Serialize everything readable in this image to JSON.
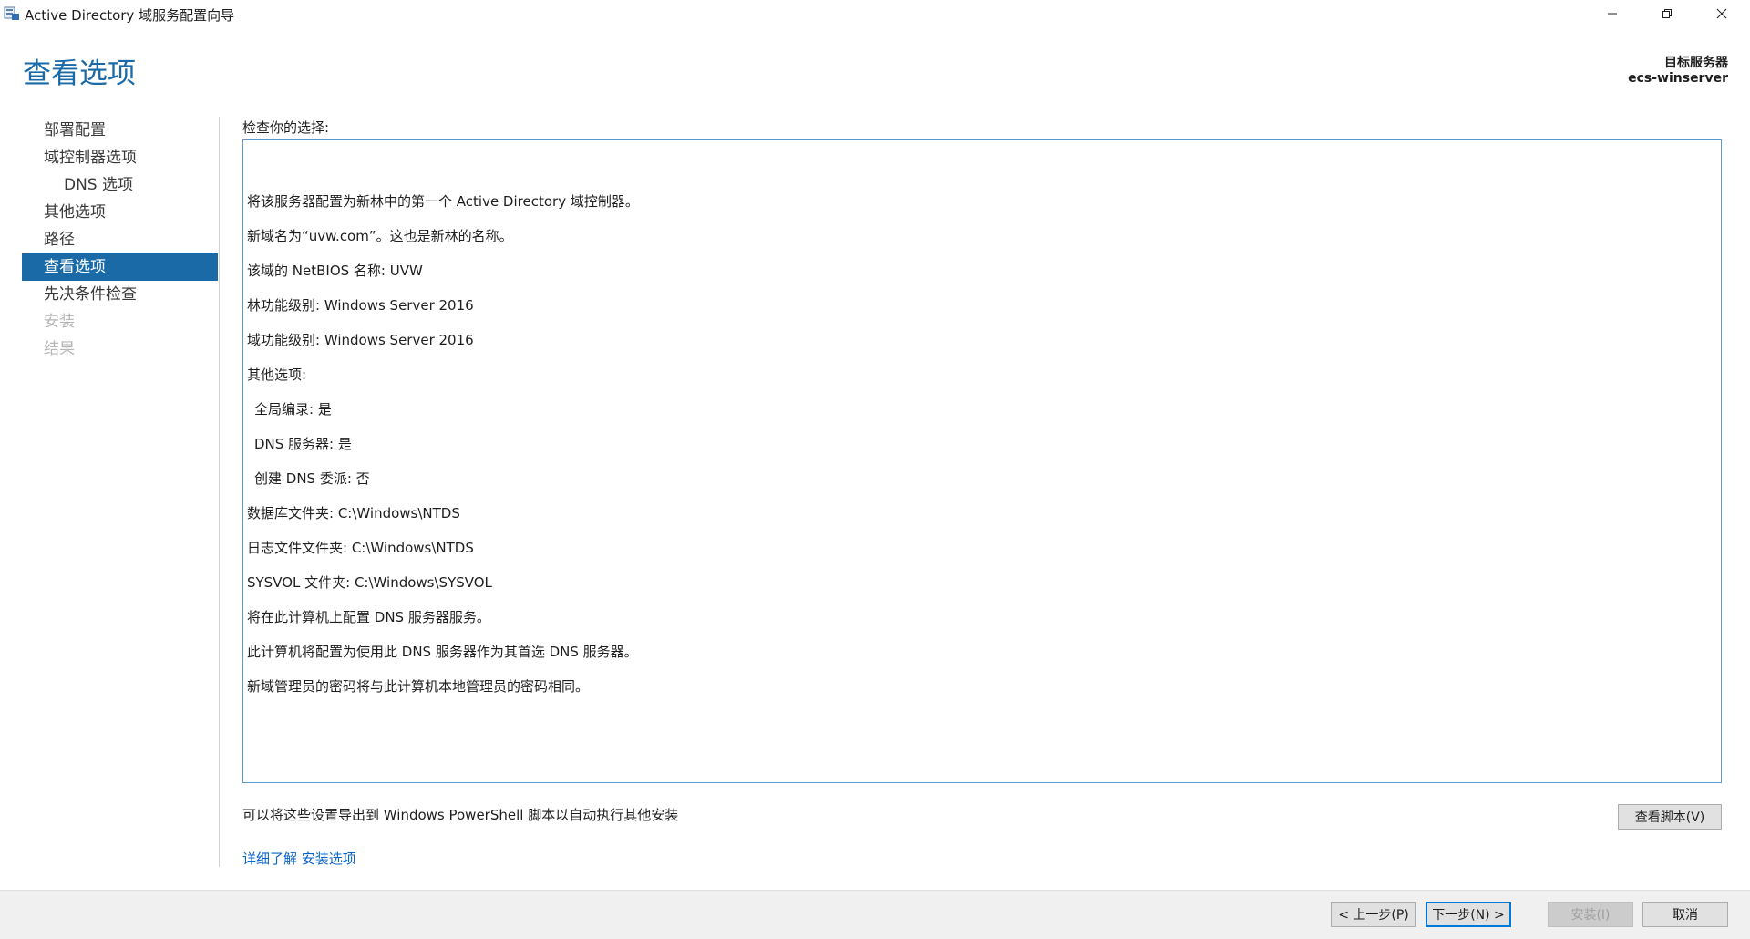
{
  "window": {
    "title": "Active Directory 域服务配置向导",
    "icon": "server-icon"
  },
  "header": {
    "page_title": "查看选项",
    "target_server_label": "目标服务器",
    "target_server_name": "ecs-winserver"
  },
  "nav": {
    "items": [
      {
        "label": "部署配置",
        "state": "normal"
      },
      {
        "label": "域控制器选项",
        "state": "normal"
      },
      {
        "label": "DNS 选项",
        "state": "sub"
      },
      {
        "label": "其他选项",
        "state": "normal"
      },
      {
        "label": "路径",
        "state": "normal"
      },
      {
        "label": "查看选项",
        "state": "active"
      },
      {
        "label": "先决条件检查",
        "state": "normal"
      },
      {
        "label": "安装",
        "state": "disabled"
      },
      {
        "label": "结果",
        "state": "disabled"
      }
    ]
  },
  "review": {
    "label": "检查你的选择:",
    "lines": [
      "将该服务器配置为新林中的第一个 Active Directory 域控制器。",
      "新域名为“uvw.com”。这也是新林的名称。",
      "该域的 NetBIOS 名称: UVW",
      "林功能级别: Windows Server 2016",
      "域功能级别: Windows Server 2016",
      "其他选项:",
      "全局编录: 是",
      "DNS 服务器: 是",
      "创建 DNS 委派: 否",
      "数据库文件夹: C:\\Windows\\NTDS",
      "日志文件文件夹: C:\\Windows\\NTDS",
      "SYSVOL 文件夹: C:\\Windows\\SYSVOL",
      "将在此计算机上配置 DNS 服务器服务。",
      "此计算机将配置为使用此 DNS 服务器作为其首选 DNS 服务器。",
      "新域管理员的密码将与此计算机本地管理员的密码相同。"
    ]
  },
  "export": {
    "text": "可以将这些设置导出到 Windows PowerShell 脚本以自动执行其他安装",
    "view_script_label": "查看脚本(V)"
  },
  "learn_more": "详细了解 安装选项",
  "footer": {
    "prev_label": "< 上一步(P)",
    "next_label": "下一步(N) >",
    "install_label": "安装(I)",
    "cancel_label": "取消"
  },
  "colors": {
    "accent": "#1a6aa8",
    "link": "#0a64c8",
    "box_border": "#5b9bd5"
  }
}
